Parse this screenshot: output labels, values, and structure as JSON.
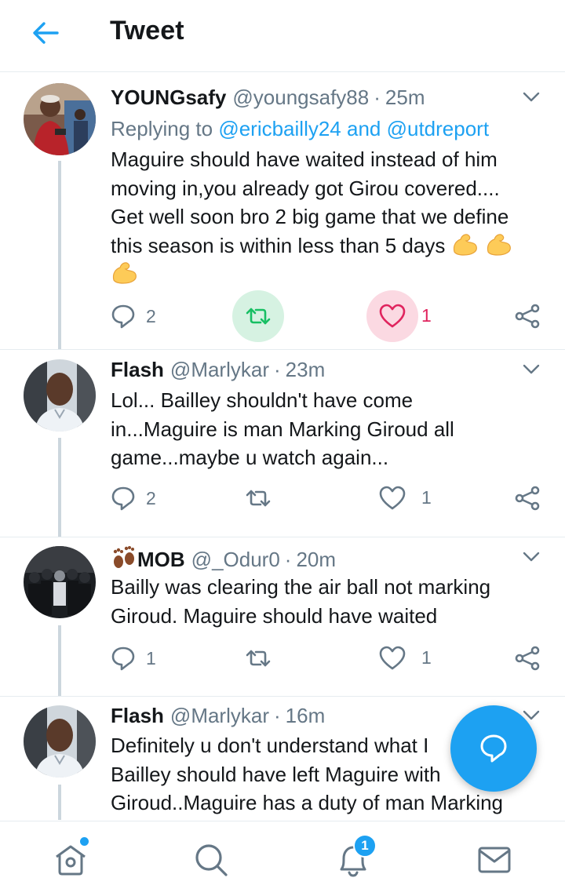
{
  "header": {
    "title": "Tweet"
  },
  "colors": {
    "accent": "#1da1f2",
    "retweet": "#17bf63",
    "like": "#e0245e",
    "muted": "#657786"
  },
  "tweets": [
    {
      "name": "YOUNGsafy",
      "handle": "@youngsafy88",
      "time": "25m",
      "replying_prefix": "Replying to ",
      "replying_mentions": "@ericbailly24 and @utdreport",
      "lines": [
        "Maguire should have waited instead of him",
        "moving in,you already got Girou covered....",
        "Get well soon bro 2 big game that we define",
        "this season is within less than 5 days"
      ],
      "emoji": "flexed-biceps",
      "replies": "2",
      "retweets": "",
      "likes": "1"
    },
    {
      "name": "Flash",
      "handle": "@Marlykar",
      "time": "23m",
      "lines": [
        "Lol... Bailley shouldn't have come",
        "in...Maguire is man Marking Giroud all",
        "game...maybe u watch again..."
      ],
      "replies": "2",
      "retweets": "",
      "likes": "1"
    },
    {
      "name_prefix_emoji": "footprints",
      "name": "MOB",
      "handle": "@_Odur0",
      "time": "20m",
      "lines": [
        "Bailly was clearing the air ball not marking",
        "Giroud. Maguire should have waited"
      ],
      "replies": "1",
      "retweets": "",
      "likes": "1"
    },
    {
      "name": "Flash",
      "handle": "@Marlykar",
      "time": "16m",
      "lines": [
        "Definitely u don't understand what I",
        "Bailley should have left Maguire with",
        "Giroud..Maguire has a duty of man Marking"
      ]
    }
  ],
  "bottom_nav": {
    "notifications_badge": "1"
  }
}
